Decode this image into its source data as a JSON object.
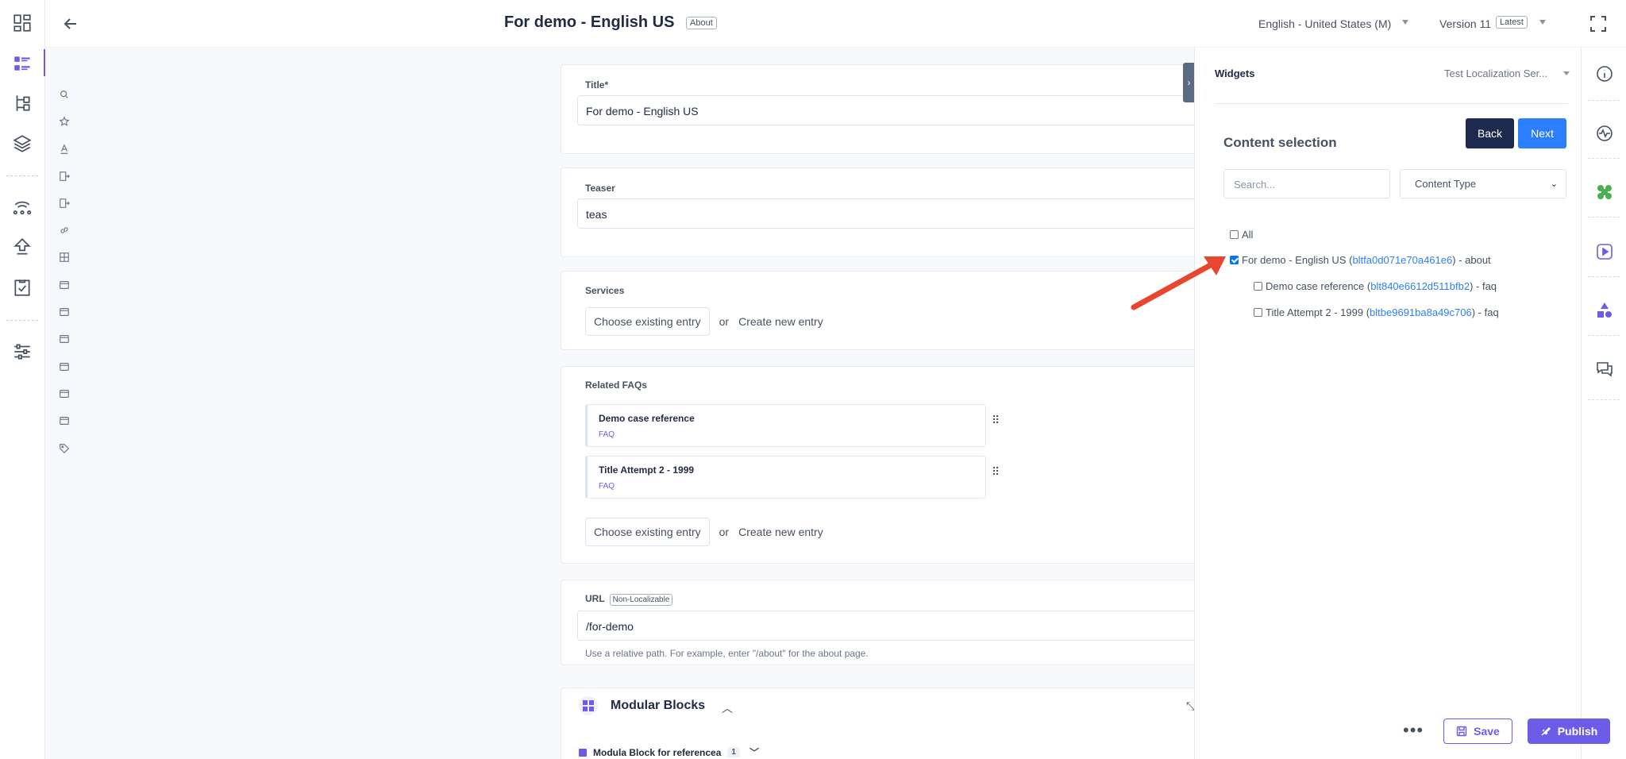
{
  "header": {
    "entry_title": "For demo - English US",
    "content_type_badge": "About",
    "locale": "English - United States (M)",
    "version": "Version 11",
    "version_badge": "Latest"
  },
  "fields": {
    "title": {
      "label": "Title*",
      "value": "For demo - English US"
    },
    "teaser": {
      "label": "Teaser",
      "value": "teas"
    },
    "services": {
      "label": "Services",
      "choose": "Choose existing entry",
      "or": "or",
      "create": "Create new entry"
    },
    "related_faqs": {
      "label": "Related FAQs",
      "items": [
        {
          "title": "Demo case reference",
          "type": "FAQ"
        },
        {
          "title": "Title Attempt 2 - 1999",
          "type": "FAQ"
        }
      ],
      "choose": "Choose existing entry",
      "or": "or",
      "create": "Create new entry"
    },
    "url": {
      "label": "URL",
      "badge": "Non-Localizable",
      "value": "/for-demo",
      "help": "Use a relative path. For example, enter \"/about\" for the about page."
    },
    "modular_blocks": {
      "title": "Modular Blocks",
      "sub_title": "Modula Block for referencea",
      "sub_count": "1"
    }
  },
  "widget_panel": {
    "title": "Widgets",
    "selected_widget": "Test Localization Ser...",
    "section_title": "Content selection",
    "back_label": "Back",
    "next_label": "Next",
    "search_placeholder": "Search...",
    "content_type_placeholder": "Content Type",
    "tree": {
      "all_label": "All",
      "items": [
        {
          "title": "For demo - English US",
          "uid": "bltfa0d071e70a461e6",
          "ct": "about",
          "checked": true,
          "level": 0
        },
        {
          "title": "Demo case reference",
          "uid": "blt840e6612d511bfb2",
          "ct": "faq",
          "checked": false,
          "level": 1
        },
        {
          "title": "Title Attempt 2 - 1999",
          "uid": "bltbe9691ba8a49c706",
          "ct": "faq",
          "checked": false,
          "level": 1
        }
      ]
    }
  },
  "actions": {
    "save_label": "Save",
    "publish_label": "Publish"
  },
  "colors": {
    "accent": "#6c5ce7",
    "primary_blue": "#2b7fff",
    "dark_navy": "#1d2a4d",
    "annotation_arrow": "#e8462f"
  },
  "icons": {
    "left_rail": [
      "dashboard-icon",
      "entries-icon",
      "content-models-icon",
      "assets-icon",
      "webhooks-icon",
      "deploy-icon",
      "tasks-icon",
      "settings-icon"
    ],
    "field_tools": [
      "search-icon",
      "star-icon",
      "text-icon",
      "reference-icon",
      "reference-icon",
      "link-icon",
      "table-icon",
      "block-icon",
      "block-icon",
      "block-icon",
      "block-icon",
      "block-icon",
      "block-icon",
      "tag-icon"
    ],
    "right_rail": [
      "info-icon",
      "activity-icon",
      "apps-icon",
      "video-icon",
      "shapes-icon",
      "comments-icon"
    ]
  }
}
